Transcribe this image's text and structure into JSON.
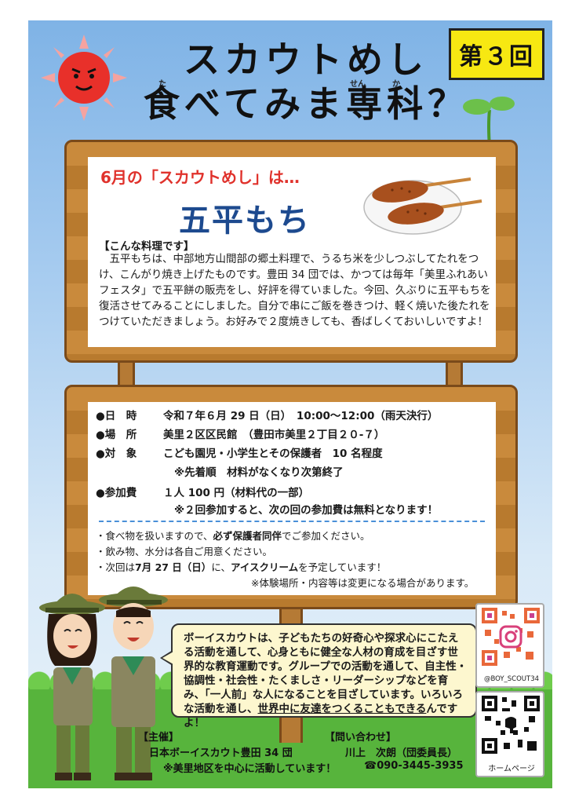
{
  "badge": "第３回",
  "title": {
    "line1": "スカウトめし",
    "line2": "食べてみま専科？",
    "ruby_ta": "た",
    "ruby_sen": "せん",
    "ruby_ka": "か"
  },
  "menu": {
    "intro": "6月の「スカウトめし」は…",
    "dish": "五平もち",
    "heading": "【こんな料理です】",
    "description": "五平もちは、中部地方山間部の郷土料理で、うるち米を少しつぶしてたれをつけ、こんがり焼き上げたものです。豊田 34 団では、かつては毎年「美里ふれあいフェスタ」で五平餅の販売をし、好評を得ていました。今回、久ぶりに五平もちを復活させてみることにしました。自分で串にご飯を巻きつけ、軽く焼いた後たれをつけていただきましょう。お好みで２度焼きしても、香ばしくておいしいですよ！"
  },
  "details": {
    "date_label": "●日　時",
    "date_value": "令和７年６月 29 日（日）　10:00～12:00（雨天決行）",
    "place_label": "●場　所",
    "place_value": "美里２区区民館　（豊田市美里２丁目２０-７）",
    "target_label": "●対　象",
    "target_value": "こども園児・小学生とその保護者　10 名程度",
    "target_note": "※先着順　材料がなくなり次第終了",
    "fee_label": "●参加費",
    "fee_value": "１人 100 円（材料代の一部）",
    "fee_note": "※２回参加すると、次の回の参加費は無料となります！"
  },
  "notes": {
    "n1_a": "・食べ物を扱いますので、",
    "n1_b": "必ず保護者同伴",
    "n1_c": "でご参加ください。",
    "n2": "・飲み物、水分は各自ご用意ください。",
    "n3_a": "・次回は",
    "n3_b": "7月 27 日（日）",
    "n3_c": "に、",
    "n3_d": "アイスクリーム",
    "n3_e": "を予定しています！",
    "n4": "※体験場所・内容等は変更になる場合があります。"
  },
  "bubble": {
    "text_a": "ボーイスカウトは、子どもたちの好奇心や探求心にこたえる活動を通して、心身ともに健全な人材の育成を目ざす世界的な教育運動です。グループでの活動を通して、自主性・協調性・社会性・たくましさ・リーダーシップなどを育み、「一人前」な人になることを目ざしています。いろいろな活動を通し、",
    "text_b": "世界中に友達をつくることもできる",
    "text_c": "んですよ！"
  },
  "qr": {
    "instagram_label": "@BOY_SCOUT34",
    "homepage_label": "ホームページ"
  },
  "footer": {
    "org_heading": "【主催】",
    "org_name": "日本ボーイスカウト豊田 34 団",
    "org_note": "※美里地区を中心に活動しています！",
    "contact_heading": "【問い合わせ】",
    "contact_name": "川上　次朗（団委員長）",
    "contact_phone": "☎090-3445-3935"
  },
  "colors": {
    "accent_red": "#e0322c",
    "dish_blue": "#1d4a8f",
    "badge_yellow": "#f7e812",
    "wood": "#c98a3c",
    "grass": "#57b43c"
  }
}
